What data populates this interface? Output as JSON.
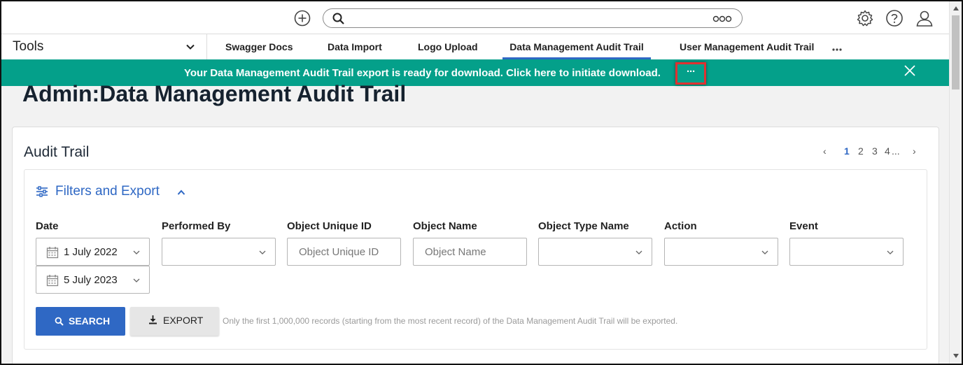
{
  "topbar": {
    "add_icon": "plus-circle-icon",
    "search": {
      "value": "",
      "placeholder": "",
      "icon": "search-icon",
      "more_icon": "more-dots-icon"
    },
    "icons": [
      "gear-icon",
      "help-icon",
      "user-icon"
    ]
  },
  "tabbar": {
    "tools_label": "Tools",
    "tabs": [
      {
        "label": "Swagger Docs",
        "active": false
      },
      {
        "label": "Data Import",
        "active": false
      },
      {
        "label": "Logo Upload",
        "active": false
      },
      {
        "label": "Data Management Audit Trail",
        "active": true
      },
      {
        "label": "User Management Audit Trail",
        "active": false
      }
    ],
    "more_icon": "more-horizontal-icon"
  },
  "banner": {
    "message": "Your Data Management Audit Trail export is ready for download. Click here to initiate download.",
    "more_label": "···",
    "close_icon": "close-icon",
    "color": "#04a08a",
    "highlight_color": "#e03131"
  },
  "page": {
    "title": "Admin:Data Management Audit Trail"
  },
  "card": {
    "title": "Audit Trail",
    "pagination": {
      "prev": "‹",
      "pages": [
        "1",
        "2",
        "3",
        "4"
      ],
      "ellipsis": "...",
      "next": "›",
      "current": "1"
    }
  },
  "filters": {
    "heading": "Filters and Export",
    "labels": {
      "date": "Date",
      "performed_by": "Performed By",
      "object_unique_id": "Object Unique ID",
      "object_name": "Object Name",
      "object_type_name": "Object Type Name",
      "action": "Action",
      "event": "Event"
    },
    "date_from": "1 July 2022",
    "date_to": "5 July 2023",
    "performed_by_value": "",
    "object_unique_id_placeholder": "Object Unique ID",
    "object_name_placeholder": "Object Name",
    "object_type_name_value": "",
    "action_value": "",
    "event_value": ""
  },
  "actions": {
    "search_label": "SEARCH",
    "export_label": "EXPORT",
    "note": "Only the first 1,000,000 records (starting from the most recent record) of the Data Management Audit Trail will be exported."
  },
  "colors": {
    "accent": "#2f68c4",
    "banner": "#04a08a"
  }
}
